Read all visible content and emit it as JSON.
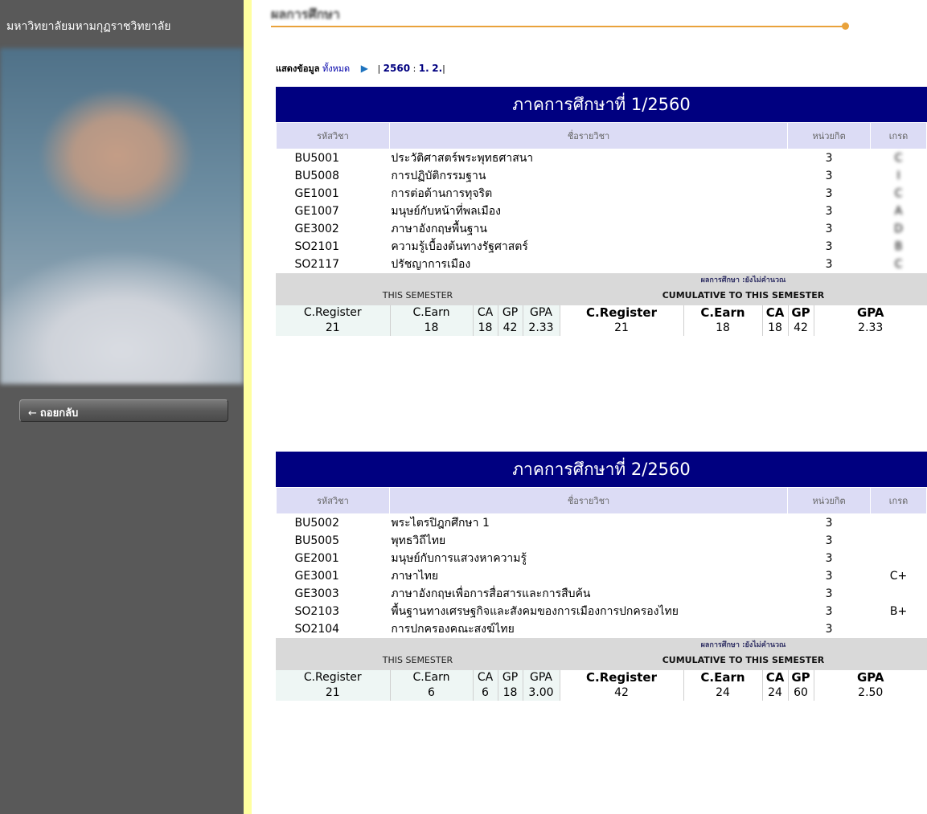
{
  "sidebar": {
    "university_name": "มหาวิทยาลัยมหามกุฏราชวิทยาลัย",
    "back_label": "ถอยกลับ"
  },
  "page_title": "ผลการศึกษา",
  "filter": {
    "label": "แสดงข้อมูล",
    "all_link": "ทั้งหมด",
    "separator": "|",
    "year": "2560",
    "colon": ":",
    "sem1": "1.",
    "sem2": "2.",
    "end": "|"
  },
  "headers": {
    "code": "รหัสวิชา",
    "name": "ชื่อรายวิชา",
    "credit": "หน่วยกิต",
    "grade": "เกรด"
  },
  "summary_labels": {
    "status": "ผลการศึกษา :ยังไม่คำนวณ",
    "this_semester": "THIS SEMESTER",
    "cumulative": "CUMULATIVE TO THIS SEMESTER",
    "c_register": "C.Register",
    "c_earn": "C.Earn",
    "ca": "CA",
    "gp": "GP",
    "gpa": "GPA"
  },
  "semesters": [
    {
      "title": "ภาคการศึกษาที่ 1/2560",
      "courses": [
        {
          "code": "BU5001",
          "name": "ประวัติศาสตร์พระพุทธศาสนา",
          "credit": "3",
          "grade": "C"
        },
        {
          "code": "BU5008",
          "name": "การปฏิบัติกรรมฐาน",
          "credit": "3",
          "grade": "I"
        },
        {
          "code": "GE1001",
          "name": "การต่อต้านการทุจริต",
          "credit": "3",
          "grade": "C"
        },
        {
          "code": "GE1007",
          "name": "มนุษย์กับหน้าที่พลเมือง",
          "credit": "3",
          "grade": "A"
        },
        {
          "code": "GE3002",
          "name": "ภาษาอังกฤษพื้นฐาน",
          "credit": "3",
          "grade": "D"
        },
        {
          "code": "SO2101",
          "name": "ความรู้เบื้องต้นทางรัฐศาสตร์",
          "credit": "3",
          "grade": "B"
        },
        {
          "code": "SO2117",
          "name": "ปรัชญาการเมือง",
          "credit": "3",
          "grade": "C"
        }
      ],
      "this": {
        "c_register": "21",
        "c_earn": "18",
        "ca": "18",
        "gp": "42",
        "gpa": "2.33"
      },
      "cum": {
        "c_register": "21",
        "c_earn": "18",
        "ca": "18",
        "gp": "42",
        "gpa": "2.33"
      }
    },
    {
      "title": "ภาคการศึกษาที่ 2/2560",
      "courses": [
        {
          "code": "BU5002",
          "name": "พระไตรปิฎกศึกษา 1",
          "credit": "3",
          "grade": ""
        },
        {
          "code": "BU5005",
          "name": "พุทธวิถีไทย",
          "credit": "3",
          "grade": ""
        },
        {
          "code": "GE2001",
          "name": "มนุษย์กับการแสวงหาความรู้",
          "credit": "3",
          "grade": ""
        },
        {
          "code": "GE3001",
          "name": "ภาษาไทย",
          "credit": "3",
          "grade": "C+"
        },
        {
          "code": "GE3003",
          "name": "ภาษาอังกฤษเพื่อการสื่อสารและการสืบค้น",
          "credit": "3",
          "grade": ""
        },
        {
          "code": "SO2103",
          "name": "พื้นฐานทางเศรษฐกิจและสังคมของการเมืองการปกครองไทย",
          "credit": "3",
          "grade": "B+"
        },
        {
          "code": "SO2104",
          "name": "การปกครองคณะสงฆ์ไทย",
          "credit": "3",
          "grade": ""
        }
      ],
      "this": {
        "c_register": "21",
        "c_earn": "6",
        "ca": "6",
        "gp": "18",
        "gpa": "3.00"
      },
      "cum": {
        "c_register": "42",
        "c_earn": "24",
        "ca": "24",
        "gp": "60",
        "gpa": "2.50"
      }
    }
  ]
}
